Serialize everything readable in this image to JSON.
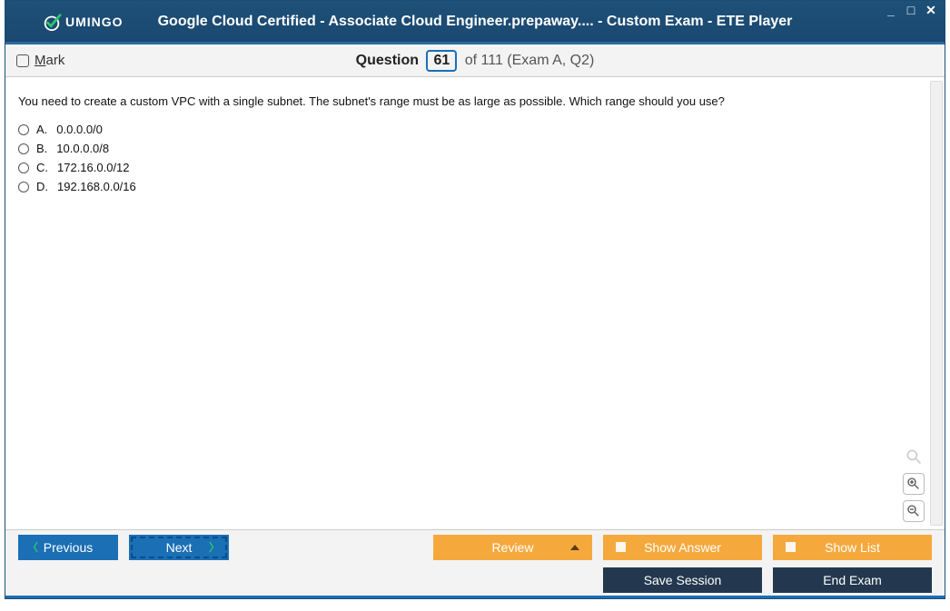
{
  "window": {
    "logo_text": "UMINGO",
    "title": "Google Cloud Certified - Associate Cloud Engineer.prepaway.... - Custom Exam - ETE Player",
    "min": "_",
    "max": "□",
    "close": "✕"
  },
  "header": {
    "mark_label": "Mark",
    "question_word": "Question",
    "current": "61",
    "of_word": "of",
    "total": "111",
    "context": "(Exam A, Q2)"
  },
  "question": {
    "text": "You need to create a custom VPC with a single subnet. The subnet's range must be as large as possible. Which range should you use?",
    "options": [
      {
        "letter": "A.",
        "text": "0.0.0.0/0"
      },
      {
        "letter": "B.",
        "text": "10.0.0.0/8"
      },
      {
        "letter": "C.",
        "text": "172.16.0.0/12"
      },
      {
        "letter": "D.",
        "text": "192.168.0.0/16"
      }
    ]
  },
  "footer": {
    "previous": "Previous",
    "next": "Next",
    "review": "Review",
    "show_answer": "Show Answer",
    "show_list": "Show List",
    "save_session": "Save Session",
    "end_exam": "End Exam"
  }
}
